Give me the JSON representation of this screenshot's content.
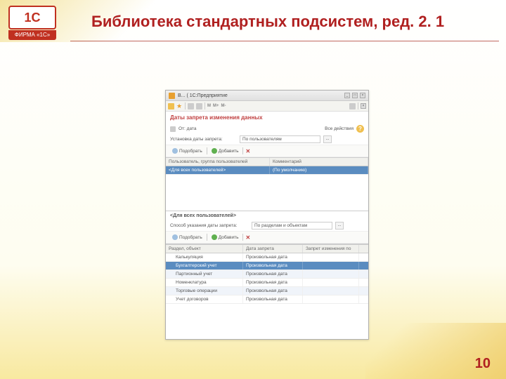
{
  "slide": {
    "title": "Библиотека стандартных подсистем, ред. 2. 1",
    "page_number": "10",
    "logo_text": "1С",
    "logo_label": "ФИРМА «1С»"
  },
  "window": {
    "title": "В...  ( 1С:Предприятие",
    "toolbar_labels": [
      "M",
      "M+",
      "M-"
    ],
    "section_title": "Даты запрета изменения данных",
    "date_label": "От: дата",
    "actions_label": "Все действия",
    "setup_label": "Установка даты запрета:",
    "setup_value": "По пользователям",
    "select_btn": "Подобрать",
    "add_btn": "Добавить",
    "grid1_col1": "Пользователь, группа пользователей",
    "grid1_col2": "Комментарий",
    "grid1_row1_c1": "<Для всех пользователей>",
    "grid1_row1_c2": "(По умолчанию)",
    "subsection": "<Для всех пользователей>",
    "method_label": "Способ указания даты запрета:",
    "method_value": "По разделам и объектам",
    "grid2_col1": "Раздел, объект",
    "grid2_col2": "Дата запрета",
    "grid2_col3": "Запрет изменения по",
    "rows": [
      {
        "c1": "Калькуляция",
        "c2": "Произвольная дата"
      },
      {
        "c1": "Бухгалтерский учет",
        "c2": "Произвольная дата"
      },
      {
        "c1": "Партионный учет",
        "c2": "Произвольная дата"
      },
      {
        "c1": "Номенклатура",
        "c2": "Произвольная дата"
      },
      {
        "c1": "Торговые операции",
        "c2": "Произвольная дата"
      },
      {
        "c1": "Учет договоров",
        "c2": "Произвольная дата"
      }
    ]
  }
}
